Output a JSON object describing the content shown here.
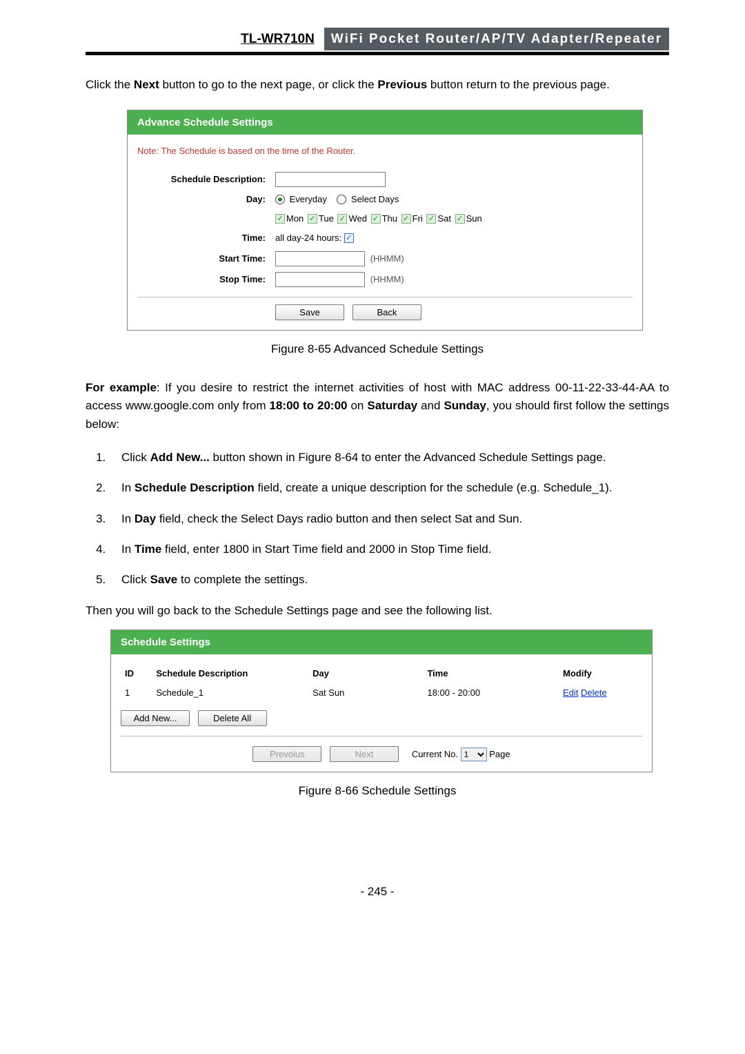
{
  "header": {
    "model": "TL-WR710N",
    "product": "WiFi Pocket Router/AP/TV Adapter/Repeater"
  },
  "intro": {
    "pre": "Click the ",
    "b1": "Next",
    "mid": " button to go to the next page, or click the ",
    "b2": "Previous",
    "post": " button return to the previous page."
  },
  "panel1": {
    "title": "Advance Schedule Settings",
    "note": "Note: The Schedule is based on the time of the Router.",
    "labels": {
      "desc": "Schedule Description:",
      "day": "Day:",
      "time": "Time:",
      "start": "Start Time:",
      "stop": "Stop Time:"
    },
    "radio": {
      "everyday": "Everyday",
      "select": "Select Days"
    },
    "days": {
      "mon": "Mon",
      "tue": "Tue",
      "wed": "Wed",
      "thu": "Thu",
      "fri": "Fri",
      "sat": "Sat",
      "sun": "Sun"
    },
    "timeLabel": "all day-24 hours:",
    "hhmm": "(HHMM)",
    "buttons": {
      "save": "Save",
      "back": "Back"
    }
  },
  "caption1": "Figure 8-65   Advanced Schedule Settings",
  "example": {
    "lead": "For example",
    "p1": ": If you desire to restrict the internet activities of host with MAC address 00-11-22-33-44-AA to access www.google.com only from ",
    "b_time": "18:00 to 20:00",
    "p2": " on ",
    "b_sat": "Saturday",
    "p3": " and ",
    "b_sun": "Sunday",
    "p4": ", you should first follow the settings below:"
  },
  "steps": {
    "s1a": "Click ",
    "s1b": "Add New...",
    "s1c": " button shown in Figure 8-64 to enter the Advanced Schedule Settings page.",
    "s2a": "In ",
    "s2b": "Schedule Description",
    "s2c": " field, create a unique description for the schedule (e.g. Schedule_1).",
    "s3a": "In ",
    "s3b": "Day",
    "s3c": " field, check the Select Days radio button and then select Sat and Sun.",
    "s4a": "In ",
    "s4b": "Time",
    "s4c": " field, enter 1800 in Start Time field and 2000 in Stop Time field.",
    "s5a": "Click ",
    "s5b": "Save",
    "s5c": " to complete the settings."
  },
  "thenline": "Then you will go back to the Schedule Settings page and see the following list.",
  "panel2": {
    "title": "Schedule Settings",
    "cols": {
      "id": "ID",
      "desc": "Schedule Description",
      "day": "Day",
      "time": "Time",
      "mod": "Modify"
    },
    "row": {
      "id": "1",
      "desc": "Schedule_1",
      "day": "Sat Sun",
      "time": "18:00 - 20:00",
      "edit": "Edit",
      "delete": "Delete"
    },
    "buttons": {
      "addnew": "Add New...",
      "deleteall": "Delete All",
      "prev": "Prevoius",
      "next": "Next"
    },
    "pager": {
      "cur": "Current No.",
      "val": "1",
      "page": "Page"
    }
  },
  "caption2": "Figure 8-66 Schedule Settings",
  "pagenum": "- 245 -"
}
